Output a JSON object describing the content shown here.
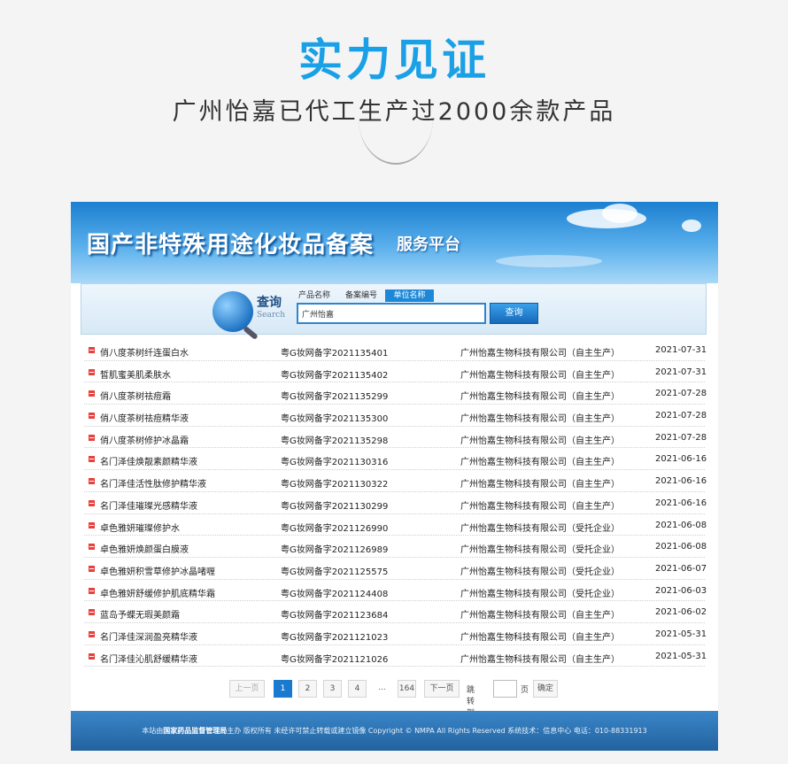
{
  "hero": {
    "title": "实力见证",
    "subtitle": "广州怡嘉已代工生产过2000余款产品"
  },
  "banner": {
    "title": "国产非特殊用途化妆品备案",
    "subtitle": "服务平台"
  },
  "search": {
    "label": "查询",
    "label_en": "Search",
    "tabs": [
      "产品名称",
      "备案编号",
      "单位名称"
    ],
    "active_tab": "单位名称",
    "value": "广州怡嘉",
    "button": "查询"
  },
  "rows": [
    {
      "name": "俏八度茶树纤连蛋白水",
      "no": "粤G妆网备字2021135401",
      "company": "广州怡嘉生物科技有限公司（自主生产）",
      "date": "2021-07-31"
    },
    {
      "name": "皙肌蜜美肌柔肤水",
      "no": "粤G妆网备字2021135402",
      "company": "广州怡嘉生物科技有限公司（自主生产）",
      "date": "2021-07-31"
    },
    {
      "name": "俏八度茶树祛痘霜",
      "no": "粤G妆网备字2021135299",
      "company": "广州怡嘉生物科技有限公司（自主生产）",
      "date": "2021-07-28"
    },
    {
      "name": "俏八度茶树祛痘精华液",
      "no": "粤G妆网备字2021135300",
      "company": "广州怡嘉生物科技有限公司（自主生产）",
      "date": "2021-07-28"
    },
    {
      "name": "俏八度茶树修护冰晶霜",
      "no": "粤G妆网备字2021135298",
      "company": "广州怡嘉生物科技有限公司（自主生产）",
      "date": "2021-07-28"
    },
    {
      "name": "名门泽佳焕靓素颜精华液",
      "no": "粤G妆网备字2021130316",
      "company": "广州怡嘉生物科技有限公司（自主生产）",
      "date": "2021-06-16"
    },
    {
      "name": "名门泽佳活性肽修护精华液",
      "no": "粤G妆网备字2021130322",
      "company": "广州怡嘉生物科技有限公司（自主生产）",
      "date": "2021-06-16"
    },
    {
      "name": "名门泽佳璀璨光感精华液",
      "no": "粤G妆网备字2021130299",
      "company": "广州怡嘉生物科技有限公司（自主生产）",
      "date": "2021-06-16"
    },
    {
      "name": "卓色雅妍璀璨修护水",
      "no": "粤G妆网备字2021126990",
      "company": "广州怡嘉生物科技有限公司（受托企业）",
      "date": "2021-06-08"
    },
    {
      "name": "卓色雅妍焕颜蛋白膜液",
      "no": "粤G妆网备字2021126989",
      "company": "广州怡嘉生物科技有限公司（受托企业）",
      "date": "2021-06-08"
    },
    {
      "name": "卓色雅妍积雪草修护冰晶啫喱",
      "no": "粤G妆网备字2021125575",
      "company": "广州怡嘉生物科技有限公司（受托企业）",
      "date": "2021-06-07"
    },
    {
      "name": "卓色雅妍舒缓修护肌底精华霜",
      "no": "粤G妆网备字2021124408",
      "company": "广州怡嘉生物科技有限公司（受托企业）",
      "date": "2021-06-03"
    },
    {
      "name": "蓝岛予蝶无瑕美颜霜",
      "no": "粤G妆网备字2021123684",
      "company": "广州怡嘉生物科技有限公司（自主生产）",
      "date": "2021-06-02"
    },
    {
      "name": "名门泽佳深润盈亮精华液",
      "no": "粤G妆网备字2021121023",
      "company": "广州怡嘉生物科技有限公司（自主生产）",
      "date": "2021-05-31"
    },
    {
      "name": "名门泽佳沁肌舒缓精华液",
      "no": "粤G妆网备字2021121026",
      "company": "广州怡嘉生物科技有限公司（自主生产）",
      "date": "2021-05-31"
    }
  ],
  "pager": {
    "prev": "上一页",
    "pages": [
      "1",
      "2",
      "3",
      "4"
    ],
    "current": "1",
    "ellipsis": "...",
    "last": "164",
    "next": "下一页",
    "jump_label": "跳转到",
    "page_unit": "页",
    "confirm": "确定"
  },
  "footer": {
    "prefix": "本站由",
    "org": "国家药品监督管理局",
    "rest": "主办 版权所有 未经许可禁止转载或建立镜像 Copyright © NMPA All Rights Reserved 系统技术：信息中心 电话：010-88331913"
  },
  "colors": {
    "accent": "#1aa0e6",
    "brand_blue": "#1e88d8",
    "bullet_red": "#e8403a"
  }
}
